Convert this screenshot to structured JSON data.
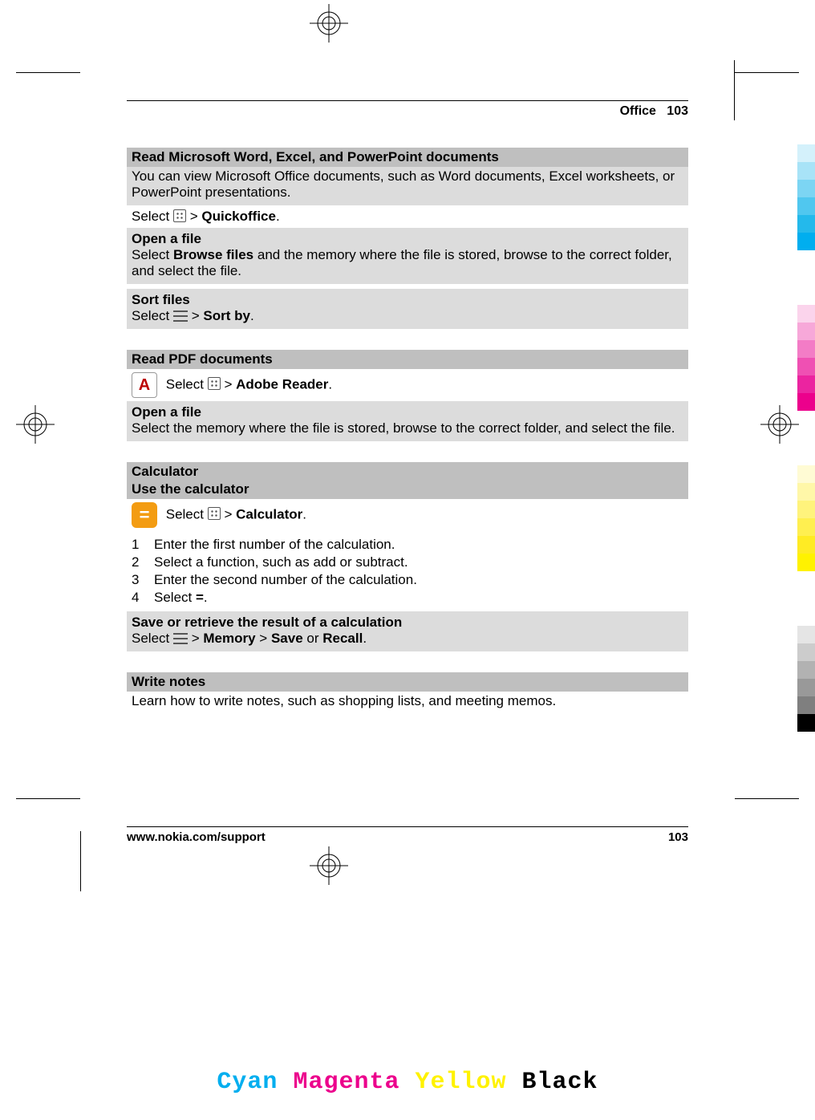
{
  "header": {
    "section": "Office",
    "page_top": "103"
  },
  "footer": {
    "url": "www.nokia.com/support",
    "page": "103"
  },
  "cmyk": {
    "c": "Cyan",
    "m": "Magenta",
    "y": "Yellow",
    "k": "Black"
  },
  "s1": {
    "title": "Read Microsoft Word, Excel, and PowerPoint documents",
    "intro": "You can view Microsoft Office documents, such as Word documents, Excel worksheets, or PowerPoint presentations.",
    "select_pre": "Select ",
    "select_sep": " > ",
    "select_app": "Quickoffice",
    "open_title": "Open a file",
    "open_body_pre": "Select ",
    "open_body_bold": "Browse files",
    "open_body_post": " and the memory where the file is stored, browse to the correct folder, and select the file.",
    "sort_title": "Sort files",
    "sort_pre": "Select ",
    "sort_sep": " > ",
    "sort_app": "Sort by"
  },
  "s2": {
    "title": "Read PDF documents",
    "select_pre": "Select ",
    "select_sep": " > ",
    "select_app": "Adobe Reader",
    "open_title": "Open a file",
    "open_body": "Select the memory where the file is stored, browse to the correct folder, and select the file."
  },
  "s3": {
    "title": "Calculator",
    "subtitle": "Use the calculator",
    "select_pre": "Select ",
    "select_sep": " > ",
    "select_app": "Calculator",
    "steps": [
      "Enter the first number of the calculation.",
      "Select a function, such as add or subtract.",
      "Enter the second number of the calculation."
    ],
    "step4_pre": "Select ",
    "step4_bold": "=",
    "step4_post": ".",
    "save_title": "Save or retrieve the result of a calculation",
    "save_pre": "Select ",
    "save_sep1": " > ",
    "save_app": "Memory",
    "save_sep2": "  > ",
    "save_opt1": "Save",
    "save_or": " or ",
    "save_opt2": "Recall"
  },
  "s4": {
    "title": "Write notes",
    "body": "Learn how to write notes, such as shopping lists, and meeting memos."
  },
  "colorbars": {
    "cyans": [
      "#d4f1fb",
      "#a8e3f7",
      "#7cd5f3",
      "#50c7ef",
      "#24b9eb",
      "#00aeef"
    ],
    "mags": [
      "#fbd4ec",
      "#f7a8d9",
      "#f37cc6",
      "#ef50b3",
      "#eb24a0",
      "#ec008c"
    ],
    "yels": [
      "#fffbd4",
      "#fff7a8",
      "#fff37c",
      "#ffef50",
      "#ffeb24",
      "#fff200"
    ],
    "blks": [
      "#e5e5e5",
      "#cccccc",
      "#b2b2b2",
      "#999999",
      "#7f7f7f",
      "#000000"
    ]
  }
}
